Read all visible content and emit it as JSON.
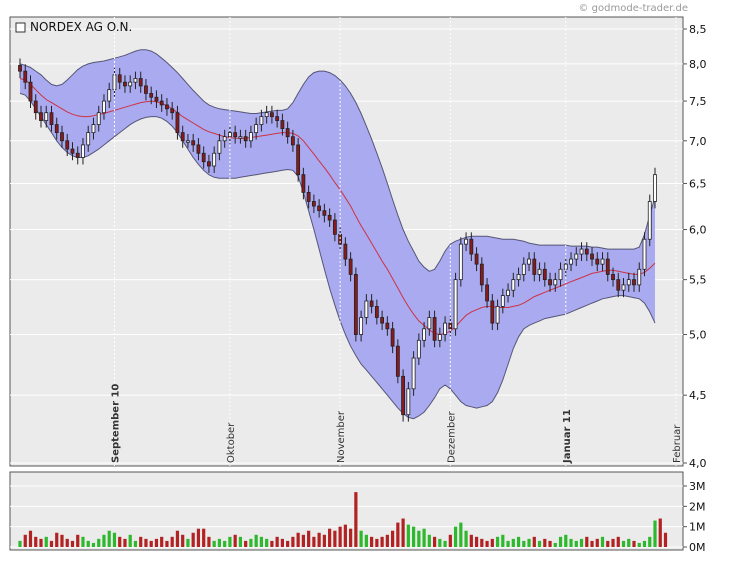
{
  "credit": "© godmode-trader.de",
  "chart_data": [
    {
      "type": "candlestick",
      "title": "NORDEX AG O.N.",
      "scale": "log",
      "ylim": [
        4.0,
        8.5
      ],
      "y_ticks": [
        "8,5",
        "8,0",
        "7,5",
        "7,0",
        "6,5",
        "6,0",
        "5,5",
        "5,0",
        "4,5",
        "4,0"
      ],
      "y_tick_values": [
        8.5,
        8.0,
        7.5,
        7.0,
        6.5,
        6.0,
        5.5,
        5.0,
        4.5,
        4.0
      ],
      "x_labels": [
        {
          "label": "September 10",
          "bold": true,
          "index": 18
        },
        {
          "label": "Oktober",
          "bold": false,
          "index": 40
        },
        {
          "label": "November",
          "bold": false,
          "index": 61
        },
        {
          "label": "Dezember",
          "bold": false,
          "index": 82
        },
        {
          "label": "Januar 11",
          "bold": true,
          "index": 104
        },
        {
          "label": "Februar",
          "bold": false,
          "index": 125
        }
      ],
      "close": [
        7.9,
        7.75,
        7.5,
        7.35,
        7.25,
        7.35,
        7.2,
        7.1,
        7.0,
        6.9,
        6.85,
        6.8,
        6.95,
        7.1,
        7.2,
        7.35,
        7.5,
        7.65,
        7.85,
        7.75,
        7.7,
        7.75,
        7.8,
        7.7,
        7.6,
        7.55,
        7.5,
        7.45,
        7.4,
        7.35,
        7.1,
        7.0,
        7.0,
        6.95,
        6.85,
        6.75,
        6.7,
        6.85,
        7.0,
        7.05,
        7.1,
        7.05,
        7.05,
        7.0,
        7.1,
        7.2,
        7.3,
        7.35,
        7.3,
        7.25,
        7.15,
        7.05,
        6.95,
        6.6,
        6.4,
        6.3,
        6.25,
        6.2,
        6.15,
        6.1,
        5.95,
        5.85,
        5.7,
        5.55,
        5.0,
        5.15,
        5.3,
        5.25,
        5.15,
        5.1,
        5.05,
        4.9,
        4.65,
        4.35,
        4.55,
        4.8,
        4.95,
        5.05,
        5.15,
        4.95,
        5.0,
        5.1,
        5.05,
        5.5,
        5.85,
        5.9,
        5.75,
        5.65,
        5.45,
        5.3,
        5.1,
        5.25,
        5.35,
        5.4,
        5.5,
        5.55,
        5.65,
        5.7,
        5.55,
        5.6,
        5.5,
        5.45,
        5.5,
        5.6,
        5.65,
        5.7,
        5.75,
        5.8,
        5.75,
        5.7,
        5.65,
        5.7,
        5.55,
        5.5,
        5.4,
        5.45,
        5.5,
        5.45,
        5.6,
        5.9,
        6.3,
        6.6
      ],
      "ma20": [
        7.8,
        7.78,
        7.72,
        7.65,
        7.58,
        7.52,
        7.48,
        7.44,
        7.4,
        7.36,
        7.33,
        7.31,
        7.3,
        7.3,
        7.31,
        7.33,
        7.34,
        7.36,
        7.38,
        7.4,
        7.42,
        7.44,
        7.46,
        7.48,
        7.49,
        7.5,
        7.49,
        7.47,
        7.44,
        7.4,
        7.35,
        7.3,
        7.26,
        7.22,
        7.18,
        7.14,
        7.11,
        7.09,
        7.07,
        7.05,
        7.04,
        7.03,
        7.03,
        7.03,
        7.04,
        7.05,
        7.06,
        7.07,
        7.08,
        7.09,
        7.1,
        7.1,
        7.09,
        7.06,
        7.0,
        6.92,
        6.84,
        6.76,
        6.68,
        6.6,
        6.51,
        6.43,
        6.34,
        6.25,
        6.14,
        6.04,
        5.95,
        5.86,
        5.77,
        5.68,
        5.6,
        5.51,
        5.42,
        5.33,
        5.25,
        5.18,
        5.12,
        5.08,
        5.04,
        5.01,
        5.0,
        5.01,
        5.03,
        5.07,
        5.12,
        5.17,
        5.2,
        5.22,
        5.24,
        5.25,
        5.25,
        5.24,
        5.24,
        5.24,
        5.25,
        5.26,
        5.28,
        5.31,
        5.34,
        5.36,
        5.38,
        5.4,
        5.42,
        5.44,
        5.46,
        5.48,
        5.5,
        5.52,
        5.54,
        5.56,
        5.57,
        5.58,
        5.59,
        5.59,
        5.58,
        5.57,
        5.56,
        5.55,
        5.55,
        5.57,
        5.61,
        5.66
      ],
      "bb_upper": [
        8.0,
        7.98,
        7.95,
        7.9,
        7.85,
        7.78,
        7.72,
        7.7,
        7.72,
        7.78,
        7.85,
        7.92,
        7.97,
        8.0,
        8.02,
        8.03,
        8.04,
        8.06,
        8.08,
        8.1,
        8.12,
        8.15,
        8.18,
        8.2,
        8.2,
        8.18,
        8.14,
        8.08,
        8.02,
        7.95,
        7.88,
        7.8,
        7.72,
        7.64,
        7.57,
        7.5,
        7.45,
        7.42,
        7.4,
        7.39,
        7.38,
        7.37,
        7.36,
        7.35,
        7.34,
        7.34,
        7.35,
        7.36,
        7.37,
        7.38,
        7.38,
        7.4,
        7.48,
        7.6,
        7.72,
        7.82,
        7.88,
        7.9,
        7.9,
        7.88,
        7.84,
        7.78,
        7.7,
        7.6,
        7.48,
        7.34,
        7.18,
        7.02,
        6.85,
        6.68,
        6.5,
        6.32,
        6.15,
        6.0,
        5.88,
        5.78,
        5.68,
        5.62,
        5.58,
        5.6,
        5.68,
        5.78,
        5.85,
        5.88,
        5.9,
        5.92,
        5.93,
        5.93,
        5.93,
        5.93,
        5.92,
        5.91,
        5.9,
        5.9,
        5.9,
        5.89,
        5.88,
        5.86,
        5.85,
        5.84,
        5.84,
        5.84,
        5.84,
        5.84,
        5.84,
        5.83,
        5.83,
        5.83,
        5.83,
        5.82,
        5.82,
        5.81,
        5.8,
        5.8,
        5.8,
        5.8,
        5.8,
        5.8,
        5.82,
        5.95,
        6.15,
        6.35
      ],
      "bb_lower": [
        7.6,
        7.58,
        7.5,
        7.4,
        7.3,
        7.2,
        7.1,
        7.0,
        6.92,
        6.86,
        6.82,
        6.8,
        6.8,
        6.82,
        6.86,
        6.9,
        6.95,
        7.0,
        7.05,
        7.1,
        7.15,
        7.2,
        7.24,
        7.27,
        7.29,
        7.3,
        7.3,
        7.28,
        7.24,
        7.18,
        7.1,
        7.0,
        6.9,
        6.8,
        6.72,
        6.65,
        6.6,
        6.57,
        6.56,
        6.56,
        6.56,
        6.56,
        6.57,
        6.58,
        6.59,
        6.6,
        6.61,
        6.62,
        6.63,
        6.64,
        6.65,
        6.66,
        6.65,
        6.58,
        6.4,
        6.2,
        6.0,
        5.8,
        5.6,
        5.42,
        5.26,
        5.12,
        5.0,
        4.9,
        4.82,
        4.75,
        4.7,
        4.65,
        4.6,
        4.55,
        4.5,
        4.45,
        4.4,
        4.36,
        4.33,
        4.32,
        4.34,
        4.37,
        4.42,
        4.48,
        4.55,
        4.58,
        4.55,
        4.5,
        4.45,
        4.42,
        4.41,
        4.4,
        4.41,
        4.42,
        4.45,
        4.52,
        4.62,
        4.75,
        4.88,
        4.98,
        5.05,
        5.08,
        5.1,
        5.12,
        5.14,
        5.15,
        5.16,
        5.17,
        5.18,
        5.2,
        5.22,
        5.24,
        5.26,
        5.28,
        5.3,
        5.32,
        5.33,
        5.34,
        5.35,
        5.35,
        5.34,
        5.33,
        5.32,
        5.28,
        5.2,
        5.1
      ]
    },
    {
      "type": "bar",
      "title": "",
      "ylim": [
        0,
        3.2
      ],
      "y_ticks": [
        "3M",
        "2M",
        "1M",
        "0M"
      ],
      "y_tick_values": [
        3,
        2,
        1,
        0
      ],
      "unit": "M",
      "values": [
        0.3,
        0.6,
        0.8,
        0.5,
        0.4,
        0.5,
        0.3,
        0.7,
        0.6,
        0.4,
        0.3,
        0.6,
        0.5,
        0.3,
        0.2,
        0.4,
        0.6,
        0.8,
        0.7,
        0.5,
        0.4,
        0.6,
        0.3,
        0.5,
        0.4,
        0.3,
        0.4,
        0.5,
        0.3,
        0.5,
        0.8,
        0.6,
        0.4,
        0.7,
        0.9,
        0.9,
        0.5,
        0.3,
        0.4,
        0.3,
        0.5,
        0.6,
        0.5,
        0.3,
        0.4,
        0.6,
        0.5,
        0.4,
        0.3,
        0.5,
        0.4,
        0.3,
        0.5,
        0.7,
        0.6,
        0.8,
        0.5,
        0.7,
        0.6,
        0.9,
        0.8,
        1.0,
        1.1,
        0.9,
        2.7,
        0.8,
        0.6,
        0.5,
        0.4,
        0.5,
        0.6,
        0.8,
        1.2,
        1.4,
        1.1,
        1.0,
        0.8,
        0.9,
        0.6,
        0.5,
        0.4,
        0.3,
        0.6,
        1.0,
        1.2,
        0.8,
        0.6,
        0.5,
        0.4,
        0.3,
        0.4,
        0.5,
        0.6,
        0.3,
        0.4,
        0.5,
        0.3,
        0.4,
        0.5,
        0.3,
        0.4,
        0.3,
        0.2,
        0.5,
        0.6,
        0.4,
        0.3,
        0.4,
        0.5,
        0.3,
        0.4,
        0.5,
        0.3,
        0.4,
        0.5,
        0.3,
        0.4,
        0.3,
        0.2,
        0.3,
        0.5,
        1.3,
        1.4,
        0.7
      ],
      "bar_colors": {
        "up": "#2eb82e",
        "down": "#b22222"
      }
    }
  ],
  "colors": {
    "band_fill": "#aaaaf0",
    "band_edge": "#555577",
    "ma_line": "#cc3344",
    "candle_up": "#ffffff",
    "candle_down": "#8b1a1a",
    "plot_bg": "#ebebeb",
    "grid": "#ffffff"
  }
}
